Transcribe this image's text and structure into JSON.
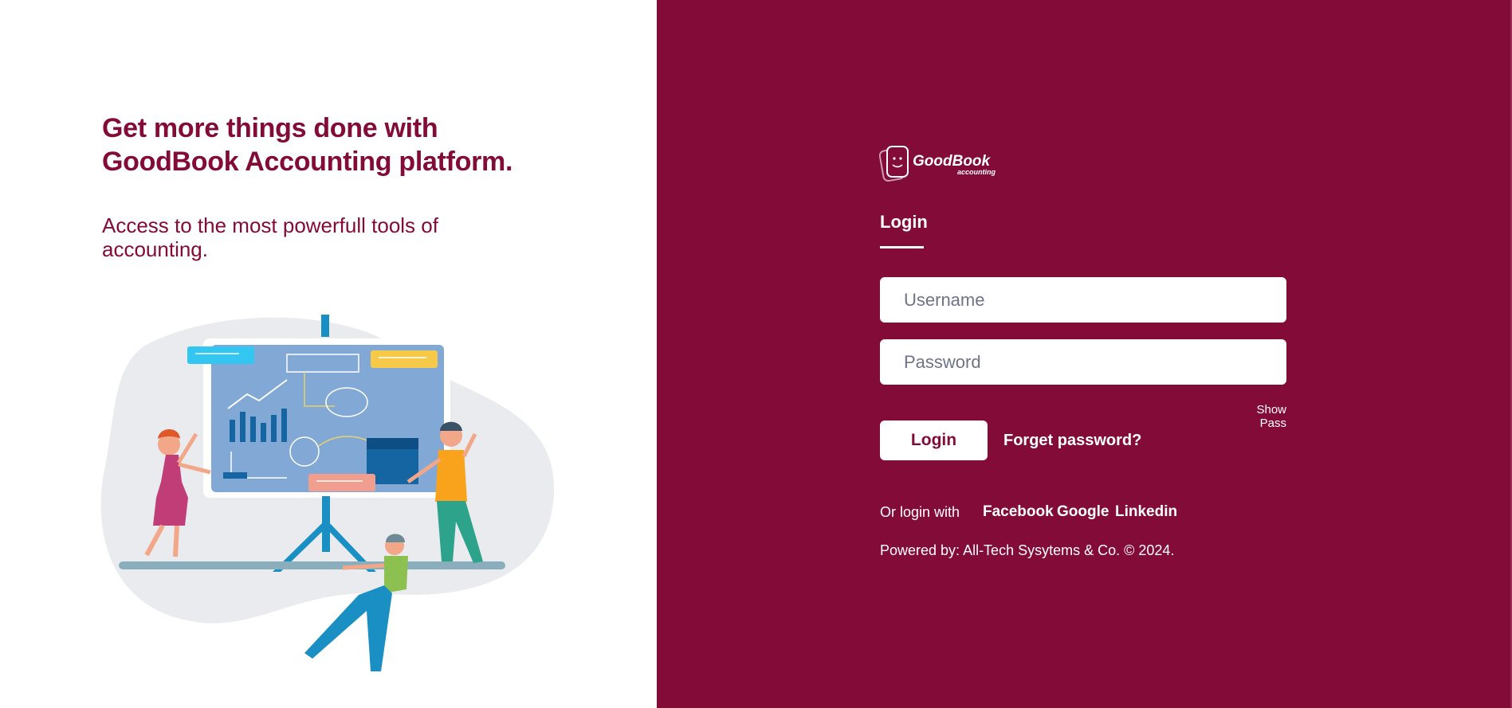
{
  "hero": {
    "headline_line1": "Get more things done with",
    "headline_line2": "GoodBook Accounting platform.",
    "subline": "Access to the most powerfull tools of accounting."
  },
  "brand": {
    "logo_name": "GoodBook",
    "logo_sub": "accounting",
    "primary_color": "#820b37"
  },
  "login": {
    "tab_label": "Login",
    "username_placeholder": "Username",
    "password_placeholder": "Password",
    "show_pass_label": "Show Pass",
    "submit_label": "Login",
    "forgot_label": "Forget password?"
  },
  "social": {
    "label": "Or login with",
    "providers": [
      "Facebook",
      "Google",
      "Linkedin"
    ]
  },
  "footer": {
    "powered_by": "Powered by: All-Tech Sysytems & Co. © 2024."
  }
}
